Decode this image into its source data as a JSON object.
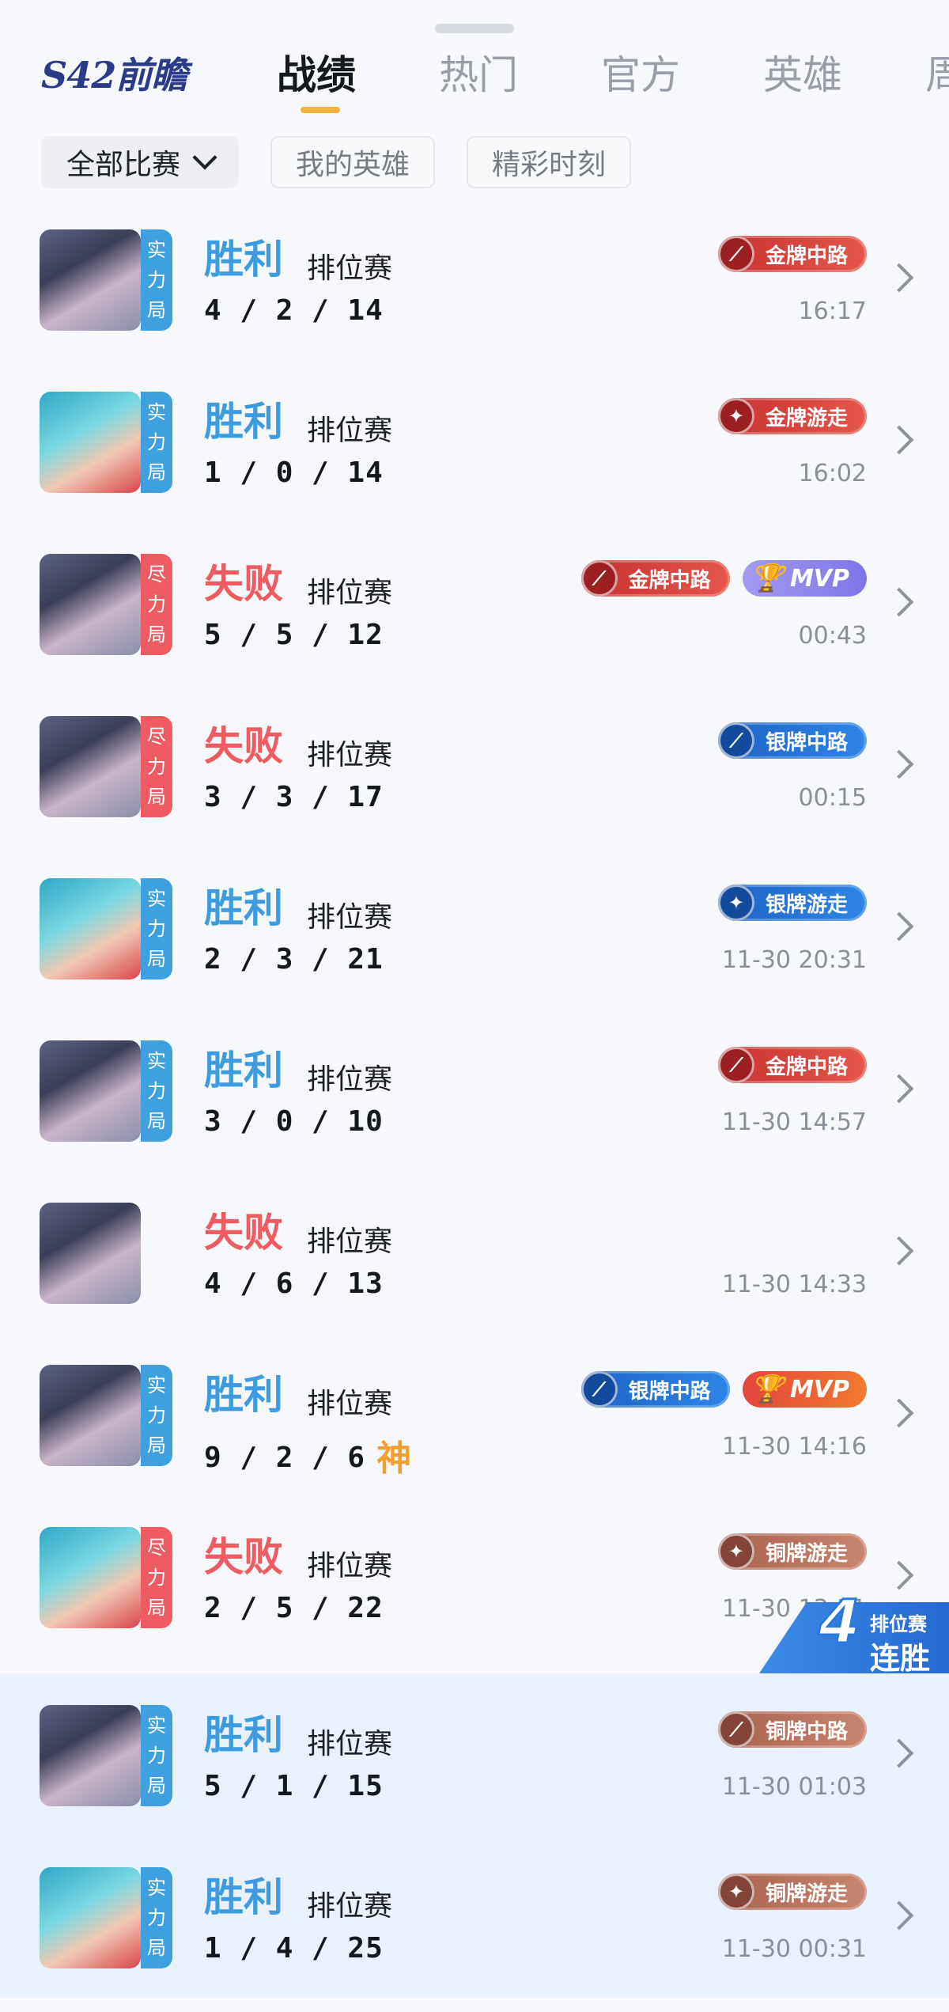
{
  "header": {
    "logo_text": "S42前瞻",
    "tabs": [
      {
        "label": "战绩",
        "active": true
      },
      {
        "label": "热门",
        "active": false
      },
      {
        "label": "官方",
        "active": false
      },
      {
        "label": "英雄",
        "active": false
      },
      {
        "label": "周",
        "active": false
      }
    ]
  },
  "filters": {
    "all_matches": "全部比赛",
    "my_heroes": "我的英雄",
    "highlights": "精彩时刻"
  },
  "matches": [
    {
      "hero": "hero-dark",
      "tag": "实力局",
      "tag_type": "strength",
      "result": "胜利",
      "win": true,
      "mode": "排位赛",
      "kda": "4 / 2 / 14",
      "badges": [
        {
          "type": "gold",
          "text": "金牌中路",
          "icon": "mid-icon"
        }
      ],
      "time": "16:17",
      "highlight": false
    },
    {
      "hero": "hero-blue",
      "tag": "实力局",
      "tag_type": "strength",
      "result": "胜利",
      "win": true,
      "mode": "排位赛",
      "kda": "1 / 0 / 14",
      "badges": [
        {
          "type": "gold",
          "text": "金牌游走",
          "icon": "roam-icon"
        }
      ],
      "time": "16:02",
      "highlight": false
    },
    {
      "hero": "hero-dark",
      "tag": "尽力局",
      "tag_type": "effort",
      "result": "失败",
      "win": false,
      "mode": "排位赛",
      "kda": "5 / 5 / 12",
      "badges": [
        {
          "type": "gold",
          "text": "金牌中路",
          "icon": "mid-icon"
        },
        {
          "type": "mvp-purple",
          "text": "MVP",
          "icon": "trophy-icon"
        }
      ],
      "time": "00:43",
      "highlight": false
    },
    {
      "hero": "hero-dark",
      "tag": "尽力局",
      "tag_type": "effort",
      "result": "失败",
      "win": false,
      "mode": "排位赛",
      "kda": "3 / 3 / 17",
      "badges": [
        {
          "type": "silver",
          "text": "银牌中路",
          "icon": "mid-icon"
        }
      ],
      "time": "00:15",
      "highlight": false
    },
    {
      "hero": "hero-blue",
      "tag": "实力局",
      "tag_type": "strength",
      "result": "胜利",
      "win": true,
      "mode": "排位赛",
      "kda": "2 / 3 / 21",
      "badges": [
        {
          "type": "silver",
          "text": "银牌游走",
          "icon": "roam-icon"
        }
      ],
      "time": "11-30 20:31",
      "highlight": false
    },
    {
      "hero": "hero-dark",
      "tag": "实力局",
      "tag_type": "strength",
      "result": "胜利",
      "win": true,
      "mode": "排位赛",
      "kda": "3 / 0 / 10",
      "badges": [
        {
          "type": "gold",
          "text": "金牌中路",
          "icon": "mid-icon"
        }
      ],
      "time": "11-30 14:57",
      "highlight": false
    },
    {
      "hero": "hero-dark",
      "tag": "",
      "tag_type": "none",
      "result": "失败",
      "win": false,
      "mode": "排位赛",
      "kda": "4 / 6 / 13",
      "badges": [],
      "time": "11-30 14:33",
      "highlight": false
    },
    {
      "hero": "hero-dark",
      "tag": "实力局",
      "tag_type": "strength",
      "result": "胜利",
      "win": true,
      "mode": "排位赛",
      "kda": "9 / 2 / 6",
      "god": "神",
      "badges": [
        {
          "type": "silver",
          "text": "银牌中路",
          "icon": "mid-icon"
        },
        {
          "type": "mvp-orange",
          "text": "MVP",
          "icon": "trophy-icon"
        }
      ],
      "time": "11-30 14:16",
      "highlight": false
    },
    {
      "hero": "hero-blue",
      "tag": "尽力局",
      "tag_type": "effort",
      "result": "失败",
      "win": false,
      "mode": "排位赛",
      "kda": "2 / 5 / 22",
      "badges": [
        {
          "type": "bronze",
          "text": "铜牌游走",
          "icon": "roam-icon"
        }
      ],
      "time": "11-30 13:51",
      "highlight": false
    },
    {
      "hero": "hero-dark",
      "tag": "实力局",
      "tag_type": "strength",
      "result": "胜利",
      "win": true,
      "mode": "排位赛",
      "kda": "5 / 1 / 15",
      "badges": [
        {
          "type": "bronze",
          "text": "铜牌中路",
          "icon": "mid-icon"
        }
      ],
      "time": "11-30 01:03",
      "highlight": true
    },
    {
      "hero": "hero-blue",
      "tag": "实力局",
      "tag_type": "strength",
      "result": "胜利",
      "win": true,
      "mode": "排位赛",
      "kda": "1 / 4 / 25",
      "badges": [
        {
          "type": "bronze",
          "text": "铜牌游走",
          "icon": "roam-icon"
        }
      ],
      "time": "11-30 00:31",
      "highlight": true
    }
  ],
  "streak": {
    "count": "4",
    "label_top": "排位赛",
    "label_bottom": "连胜"
  }
}
